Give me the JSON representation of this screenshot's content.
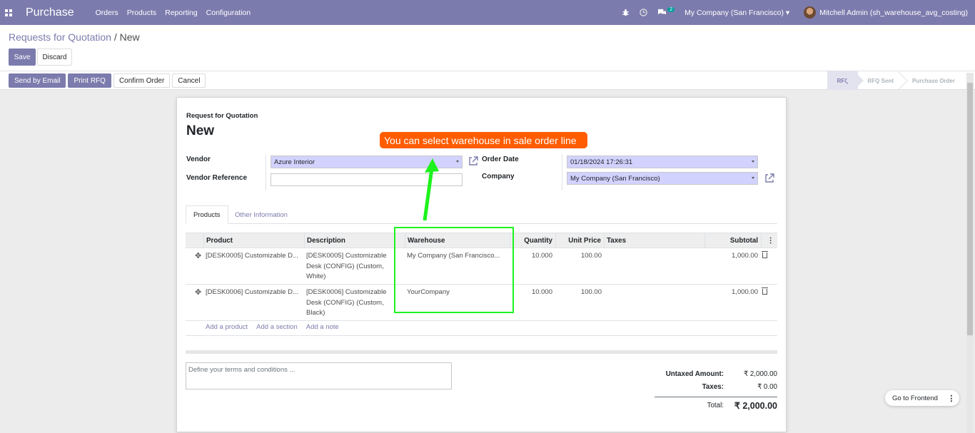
{
  "navbar": {
    "app_name": "Purchase",
    "menu": [
      "Orders",
      "Products",
      "Reporting",
      "Configuration"
    ],
    "chat_count": "2",
    "company": "My Company (San Francisco)",
    "user": "Mitchell Admin (sh_warehouse_avg_costing)"
  },
  "breadcrumb": {
    "parent": "Requests for Quotation",
    "sep": "/",
    "current": "New"
  },
  "actions": {
    "save": "Save",
    "discard": "Discard"
  },
  "statusbar": {
    "buttons": [
      "Send by Email",
      "Print RFQ",
      "Confirm Order",
      "Cancel"
    ],
    "stages": [
      "RFQ",
      "RFQ Sent",
      "Purchase Order"
    ],
    "active_stage": "RFQ"
  },
  "form": {
    "doc_label": "Request for Quotation",
    "doc_name": "New",
    "vendor_label": "Vendor",
    "vendor_value": "Azure Interior",
    "vendor_ref_label": "Vendor Reference",
    "vendor_ref_value": "",
    "order_date_label": "Order Date",
    "order_date_value": "01/18/2024 17:26:31",
    "company_label": "Company",
    "company_value": "My Company (San Francisco)"
  },
  "tabs": [
    "Products",
    "Other Information"
  ],
  "table": {
    "columns": [
      "Product",
      "Description",
      "Warehouse",
      "Quantity",
      "Unit Price",
      "Taxes",
      "Subtotal"
    ],
    "rows": [
      {
        "product": "[DESK0005] Customizable D...",
        "description": [
          "[DESK0005] Customizable",
          "Desk (CONFIG) (Custom,",
          "White)"
        ],
        "warehouse": "My Company (San Francisco...",
        "quantity": "10.000",
        "unit_price": "100.00",
        "taxes": "",
        "subtotal": "1,000.00"
      },
      {
        "product": "[DESK0006] Customizable D...",
        "description": [
          "[DESK0006] Customizable",
          "Desk (CONFIG) (Custom,",
          "Black)"
        ],
        "warehouse": "YourCompany",
        "quantity": "10.000",
        "unit_price": "100.00",
        "taxes": "",
        "subtotal": "1,000.00"
      }
    ],
    "add_links": [
      "Add a product",
      "Add a section",
      "Add a note"
    ]
  },
  "notes_placeholder": "Define your terms and conditions ...",
  "totals": {
    "untaxed_label": "Untaxed Amount:",
    "untaxed_value": "₹ 2,000.00",
    "taxes_label": "Taxes:",
    "taxes_value": "₹ 0.00",
    "total_label": "Total:",
    "total_value": "₹ 2,000.00"
  },
  "annotation": "You can select warehouse in sale order line",
  "go_to_frontend": "Go to Frontend",
  "colors": {
    "brand": "#7c7bad",
    "callout": "#ff5c00",
    "highlight": "#1ef21e",
    "required_bg": "#d2d2ff"
  }
}
